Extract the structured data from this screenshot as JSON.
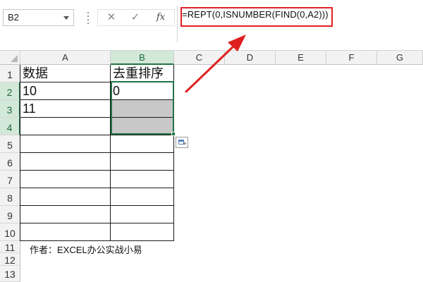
{
  "formula_bar": {
    "name_box": "B2",
    "cancel_icon": "✕",
    "enter_icon": "✓",
    "fx_label": "fx",
    "formula": "=REPT(0,ISNUMBER(FIND(0,A2)))"
  },
  "grid": {
    "columns": [
      "A",
      "B",
      "C",
      "D",
      "E",
      "F",
      "G"
    ],
    "rows": [
      "1",
      "2",
      "3",
      "4",
      "5",
      "6",
      "7",
      "8",
      "9",
      "10",
      "11",
      "12",
      "13"
    ],
    "cells": {
      "A1": "数据",
      "B1": "去重排序",
      "A2": "10",
      "B2": "0",
      "A3": "11"
    },
    "author_note": "作者：EXCEL办公实战小易"
  },
  "colors": {
    "accent": "#217346",
    "annotation": "#e02020",
    "selected_fill": "#c8c8c8"
  },
  "icons": {
    "quick_analysis": "quick-analysis-icon",
    "arrow": "red-arrow-annotation"
  }
}
